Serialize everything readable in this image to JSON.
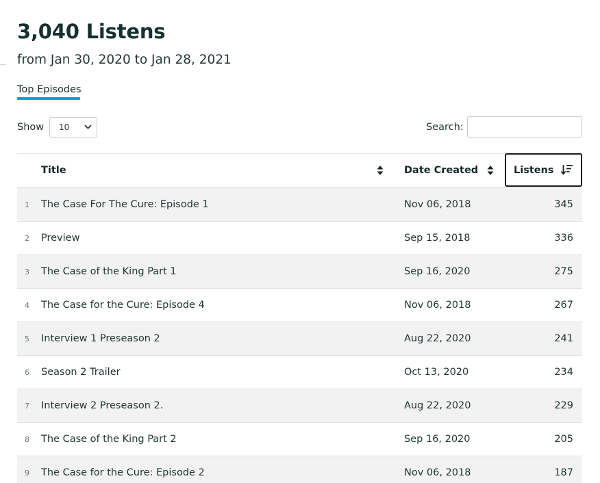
{
  "header": {
    "title": "3,040 Listens",
    "subtitle": "from Jan 30, 2020 to Jan 28, 2021"
  },
  "tabs": [
    {
      "label": "Top Episodes",
      "active": true
    }
  ],
  "controls": {
    "show_label": "Show",
    "show_value": "10",
    "search_label": "Search:",
    "search_value": ""
  },
  "table": {
    "columns": {
      "title": "Title",
      "date_created": "Date Created",
      "listens": "Listens"
    },
    "sorted_by": "listens",
    "sort_direction": "descending",
    "rows": [
      {
        "num": "1",
        "title": "The Case For The Cure: Episode 1",
        "date": "Nov 06, 2018",
        "listens": "345"
      },
      {
        "num": "2",
        "title": "Preview",
        "date": "Sep 15, 2018",
        "listens": "336"
      },
      {
        "num": "3",
        "title": "The Case of the King Part 1",
        "date": "Sep 16, 2020",
        "listens": "275"
      },
      {
        "num": "4",
        "title": "The Case for the Cure: Episode 4",
        "date": "Nov 06, 2018",
        "listens": "267"
      },
      {
        "num": "5",
        "title": "Interview 1 Preseason 2",
        "date": "Aug 22, 2020",
        "listens": "241"
      },
      {
        "num": "6",
        "title": "Season 2 Trailer",
        "date": "Oct 13, 2020",
        "listens": "234"
      },
      {
        "num": "7",
        "title": "Interview 2 Preseason 2.",
        "date": "Aug 22, 2020",
        "listens": "229"
      },
      {
        "num": "8",
        "title": "The Case of the King Part 2",
        "date": "Sep 16, 2020",
        "listens": "205"
      },
      {
        "num": "9",
        "title": "The Case for the Cure: Episode 2",
        "date": "Nov 06, 2018",
        "listens": "187"
      }
    ]
  },
  "colors": {
    "accent": "#1a9ad6",
    "row_stripe": "#f2f2f2",
    "heading": "#15302f"
  }
}
